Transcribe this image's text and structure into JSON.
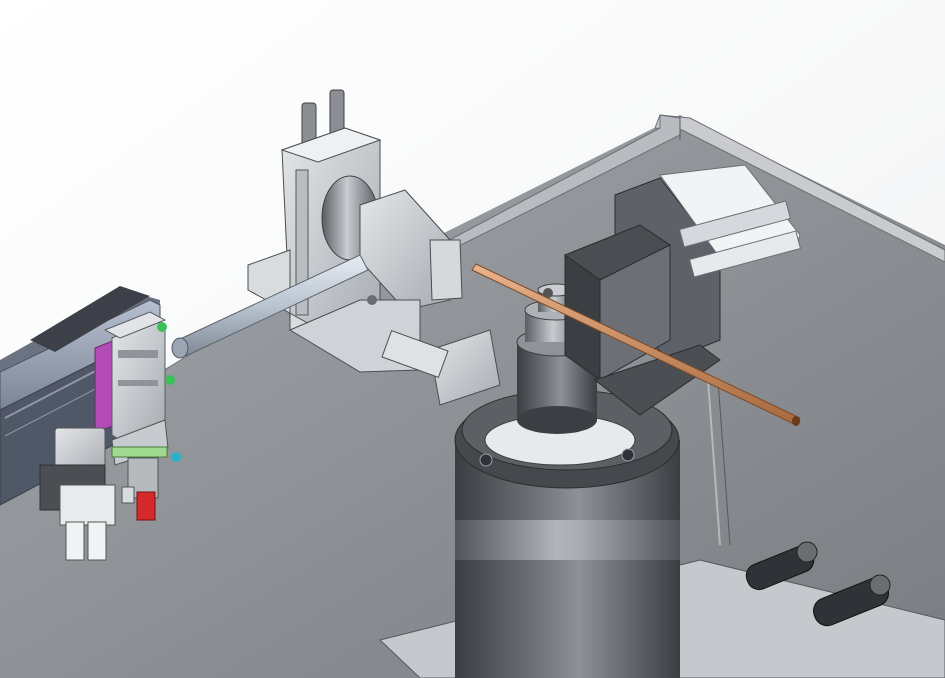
{
  "scene": {
    "kind": "cad-3d-assembly-view",
    "background": "#ffffff",
    "colors": {
      "enclosure_glass": "#8f9297",
      "enclosure_frame": "#c9cbce",
      "steel_light": "#d6d9dc",
      "steel_mid": "#a6abb0",
      "steel_dark": "#5d6166",
      "housing_dark": "#3f4246",
      "copper_tube": "#c98b5e",
      "accent_purple": "#b24bb5",
      "accent_green": "#3cc05a",
      "accent_red": "#d42a2a",
      "accent_cyan": "#28b4c8"
    },
    "components": [
      "transparent-enclosure",
      "linear-rail-module",
      "pneumatic-gripper-left",
      "vertical-cylinder-slide",
      "horizontal-rod",
      "clamping-vise",
      "copper-tube",
      "tube-bender-head",
      "rotary-base-motor",
      "knurled-adjust-knobs"
    ]
  }
}
